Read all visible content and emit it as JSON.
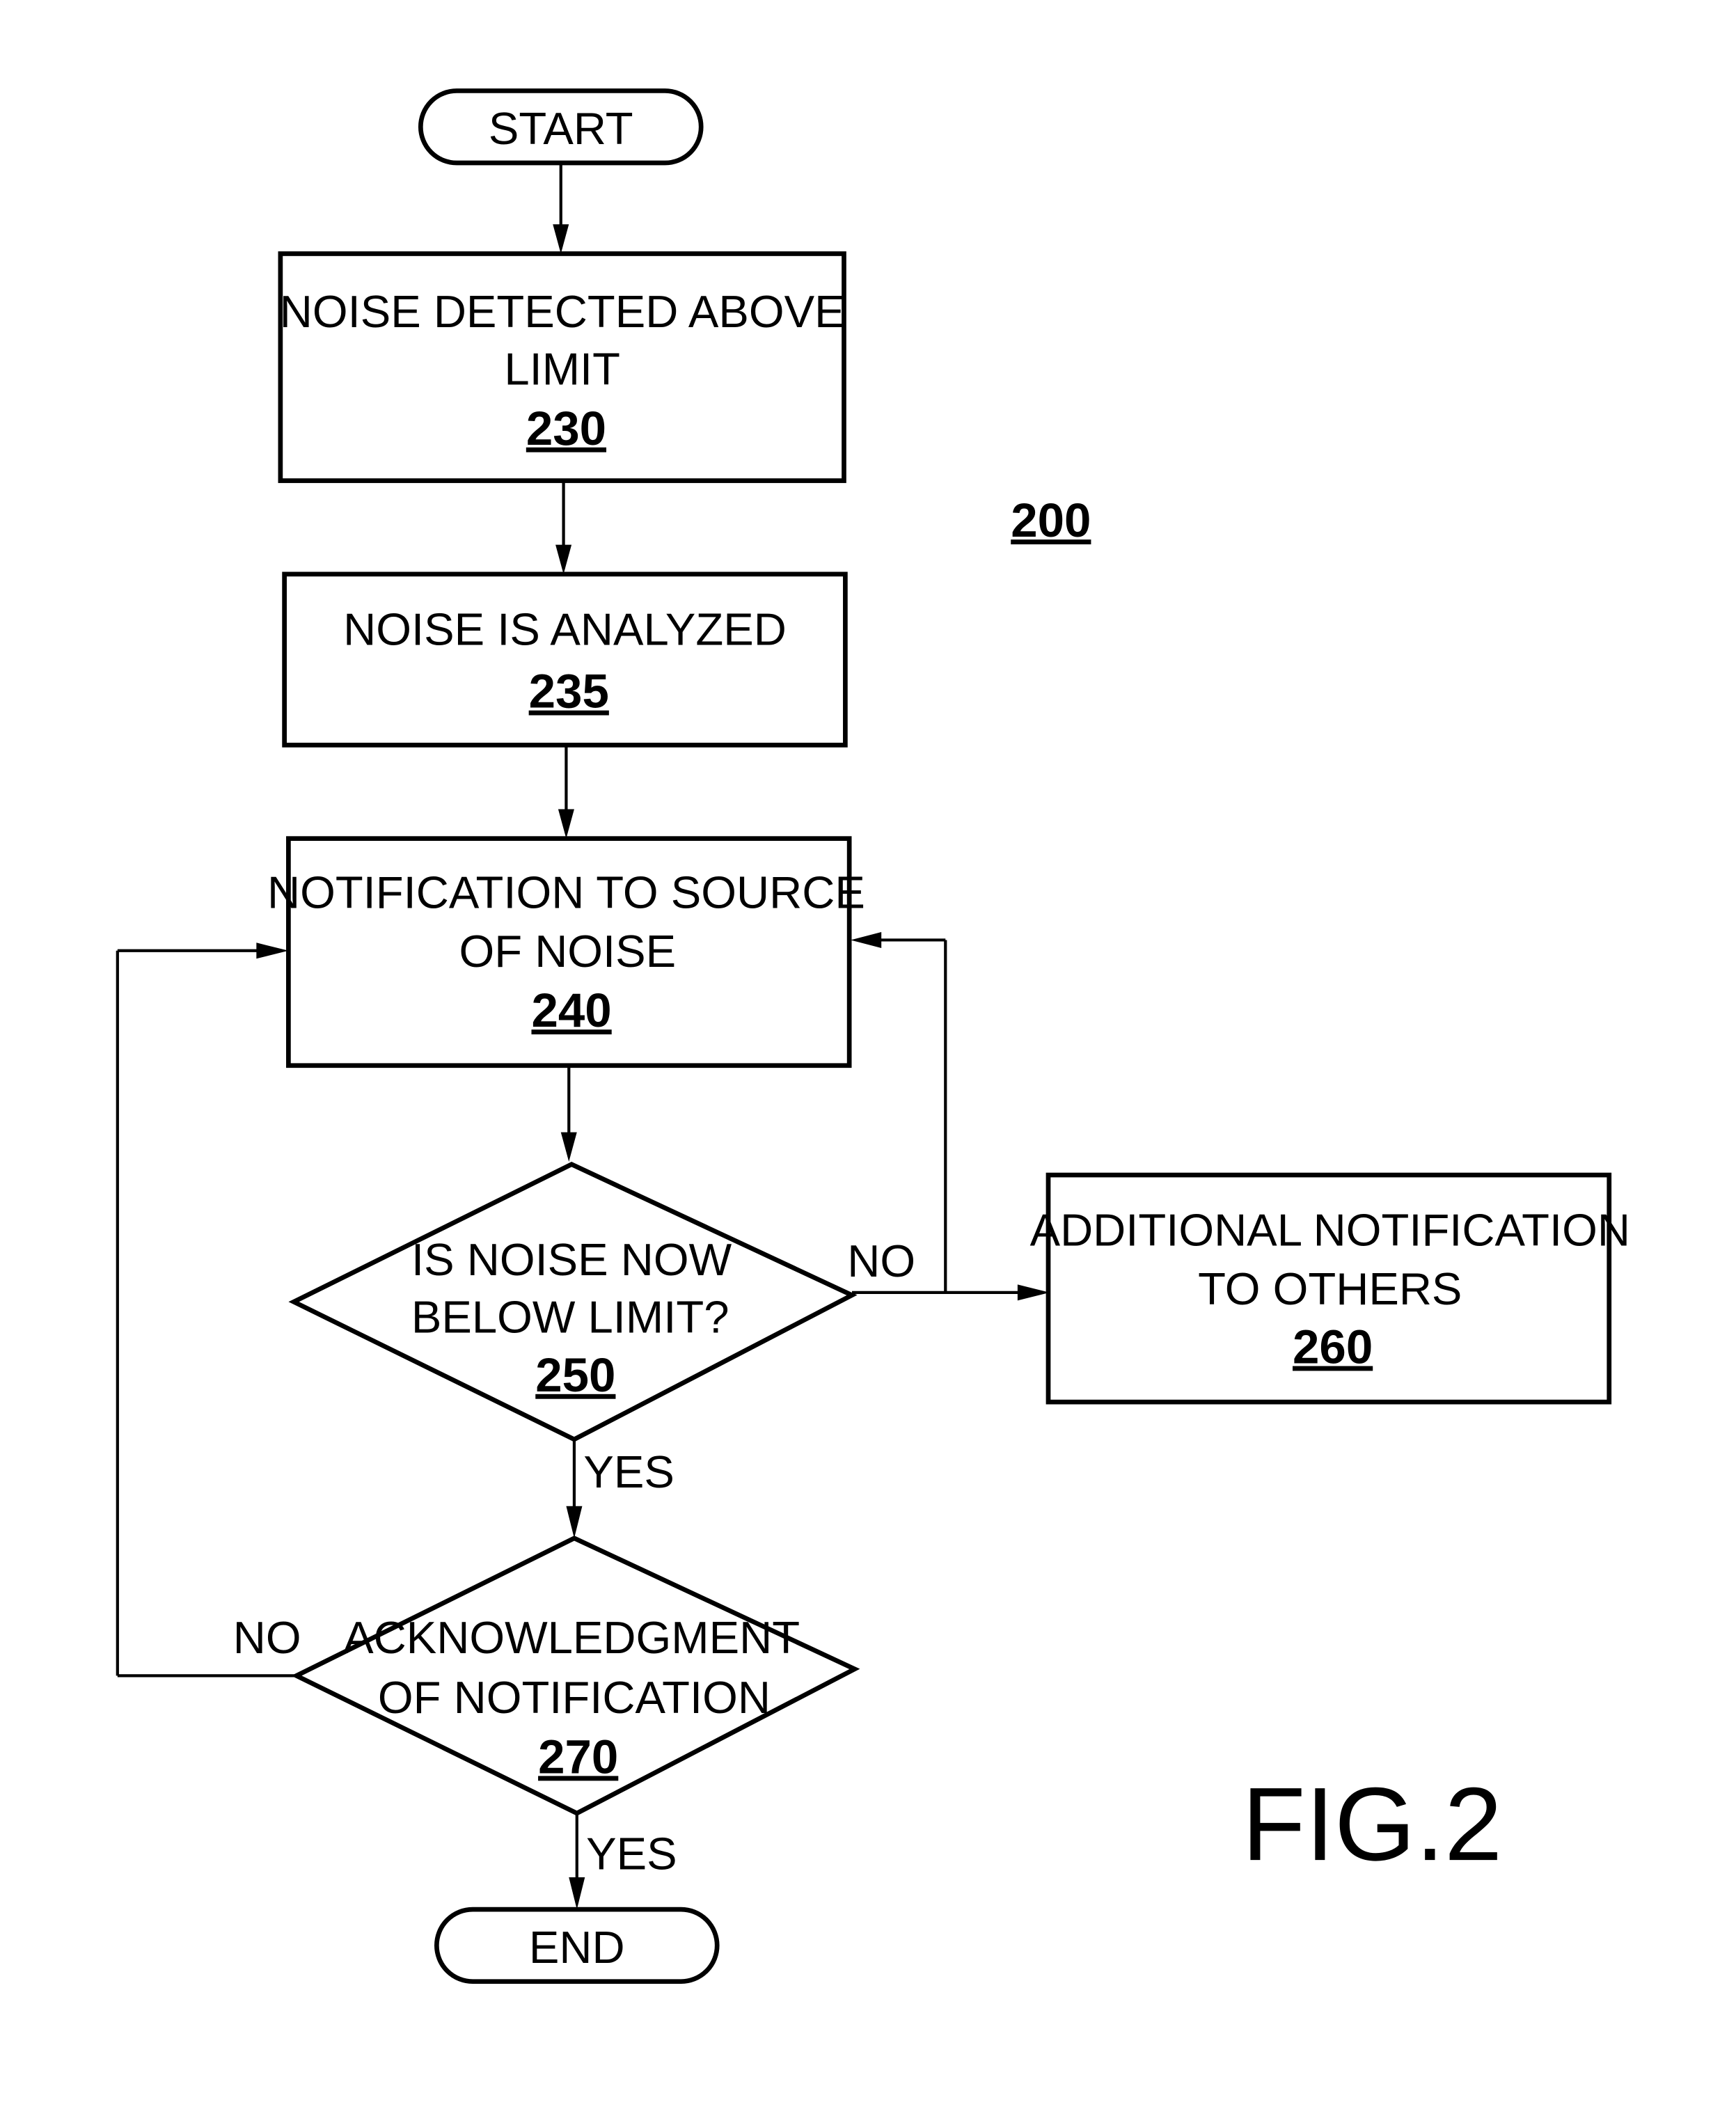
{
  "figure": {
    "label": "FIG.2",
    "reference": "200"
  },
  "nodes": {
    "start": {
      "label": "START"
    },
    "n230": {
      "lines": [
        "NOISE DETECTED ABOVE",
        "LIMIT"
      ],
      "ref": "230"
    },
    "n235": {
      "lines": [
        "NOISE IS ANALYZED"
      ],
      "ref": "235"
    },
    "n240": {
      "lines": [
        "NOTIFICATION TO SOURCE",
        "OF NOISE"
      ],
      "ref": "240"
    },
    "n250": {
      "lines": [
        "IS NOISE NOW",
        "BELOW LIMIT?"
      ],
      "ref": "250"
    },
    "n260": {
      "lines": [
        "ADDITIONAL NOTIFICATION",
        "TO OTHERS"
      ],
      "ref": "260"
    },
    "n270": {
      "lines": [
        "ACKNOWLEDGMENT",
        "OF NOTIFICATION"
      ],
      "ref": "270"
    },
    "end": {
      "label": "END"
    }
  },
  "edges": {
    "n250_no": "NO",
    "n250_yes": "YES",
    "n270_no": "NO",
    "n270_yes": "YES"
  }
}
